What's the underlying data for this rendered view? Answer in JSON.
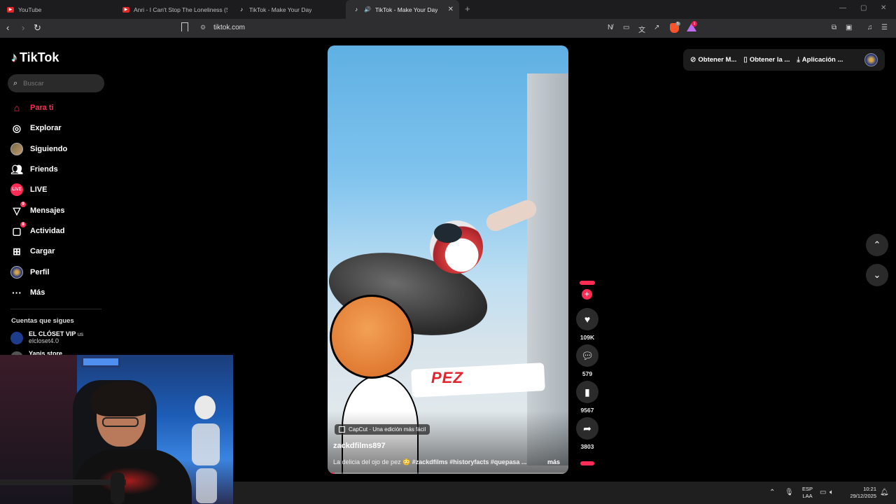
{
  "browser": {
    "tabs": [
      {
        "title": "YouTube",
        "favicon": "youtube-icon"
      },
      {
        "title": "Anri - I Can't Stop The Loneliness (Sa",
        "favicon": "youtube-icon"
      },
      {
        "title": "TikTok - Make Your Day",
        "favicon": "tiktok-icon"
      },
      {
        "title": "TikTok - Make Your Day",
        "favicon": "tiktok-icon",
        "active": true
      }
    ],
    "url": "tiktok.com",
    "brave_shield_count": "5",
    "rewards_count": "1"
  },
  "tiktok": {
    "logo_text": "TikTok",
    "search_placeholder": "Buscar",
    "nav": [
      {
        "label": "Para ti",
        "icon": "home-icon"
      },
      {
        "label": "Explorar",
        "icon": "compass-icon"
      },
      {
        "label": "Siguiendo",
        "icon": "following-avatar"
      },
      {
        "label": "Friends",
        "icon": "friends-icon"
      },
      {
        "label": "LIVE",
        "icon": "live-icon"
      },
      {
        "label": "Mensajes",
        "icon": "messages-icon",
        "badge": "9"
      },
      {
        "label": "Actividad",
        "icon": "activity-icon",
        "badge": "8"
      },
      {
        "label": "Cargar",
        "icon": "upload-icon"
      },
      {
        "label": "Perfil",
        "icon": "profile-avatar"
      },
      {
        "label": "Más",
        "icon": "more-icon"
      }
    ],
    "following_title": "Cuentas que sigues",
    "following": [
      {
        "name": "EL CLÓSET VIP",
        "flag": "us",
        "handle": "elcloset4.0"
      },
      {
        "name": "Yanis store"
      }
    ],
    "get_app": {
      "item1": "Obtener M...",
      "item2": "Obtener la ...",
      "item3": "Aplicación ..."
    },
    "video": {
      "overlay_text": "PEZ",
      "capcut_label": "CapCut · Una edición más fácil",
      "username": "zackdfilms897",
      "description_text": "La delicia del ojo de pez 😳 ",
      "hashtags": "#zackdfilms #historyfacts #quepasa ...",
      "more_label": "más"
    },
    "actions": {
      "likes": "109K",
      "comments": "579",
      "saves": "9567",
      "shares": "3803"
    }
  },
  "taskbar": {
    "lang_line1": "ESP",
    "lang_line2": "LAA",
    "time": "10:21",
    "date": "29/12/2025"
  },
  "colors": {
    "tiktok_accent": "#fe2c55",
    "background": "#000000"
  }
}
